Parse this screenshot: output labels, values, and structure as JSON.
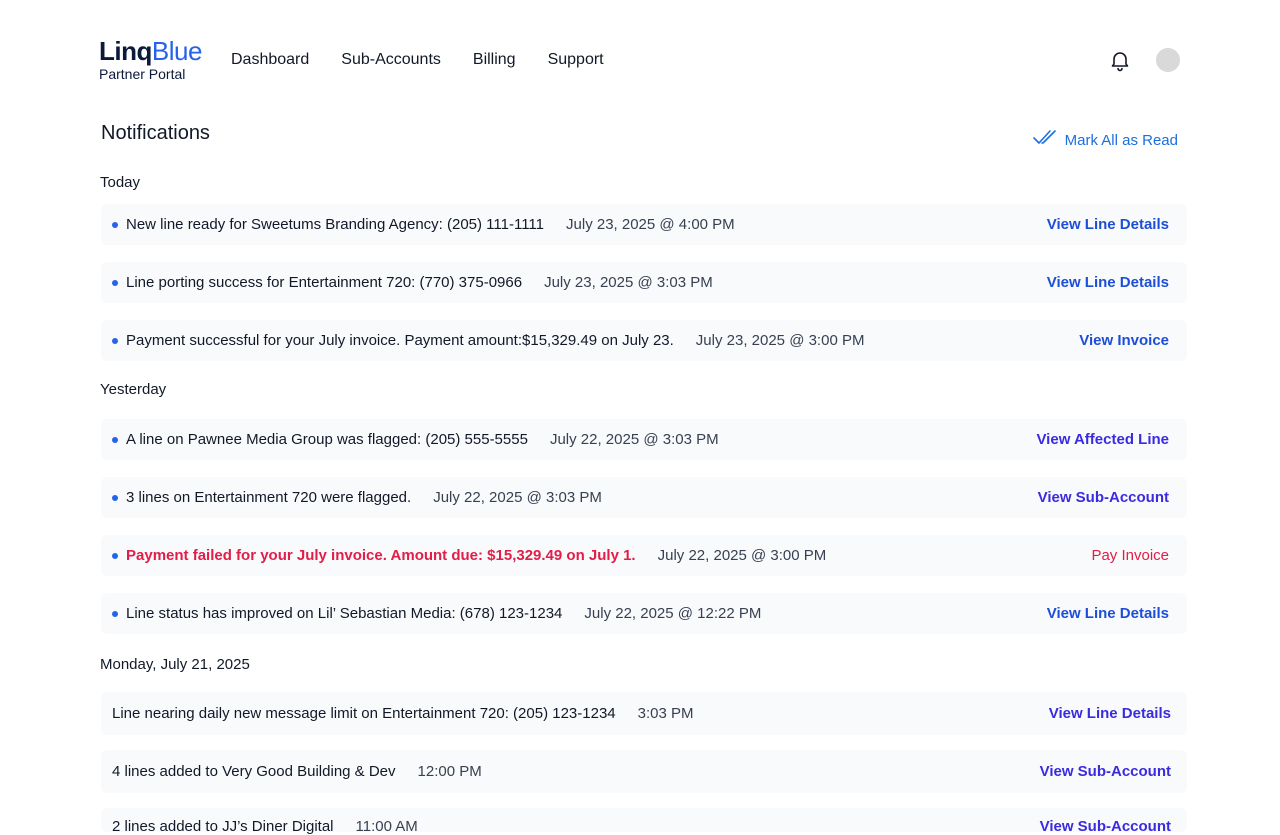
{
  "brand": {
    "name_bold": "Linq",
    "name_light": "Blue",
    "subtitle": "Partner Portal"
  },
  "nav": [
    {
      "label": "Dashboard"
    },
    {
      "label": "Sub-Accounts"
    },
    {
      "label": "Billing"
    },
    {
      "label": "Support"
    }
  ],
  "page": {
    "title": "Notifications",
    "mark_all_label": "Mark All as Read"
  },
  "sections": {
    "today": "Today",
    "yesterday": "Yesterday",
    "monday": "Monday, July 21, 2025"
  },
  "notifications": [
    {
      "message": "New line ready for Sweetums Branding Agency: (205) 111-1111",
      "time": "July 23, 2025 @ 4:00 PM",
      "action": "View Line Details"
    },
    {
      "message": "Line porting success for Entertainment 720: (770) 375-0966",
      "time": "July 23, 2025 @ 3:03 PM",
      "action": "View Line Details"
    },
    {
      "message": "Payment successful for your July invoice. Payment amount:$15,329.49 on July 23.",
      "time": "July 23, 2025 @ 3:00 PM",
      "action": "View Invoice"
    },
    {
      "message": "A line on Pawnee Media Group was flagged: (205) 555-5555",
      "time": "July 22, 2025 @ 3:03 PM",
      "action": "View Affected Line"
    },
    {
      "message": "3 lines on Entertainment 720 were flagged.",
      "time": "July 22, 2025 @ 3:03 PM",
      "action": "View Sub-Account"
    },
    {
      "message": "Payment failed for your July invoice. Amount due: $15,329.49 on July 1.",
      "time": "July 22, 2025 @ 3:00 PM",
      "action": "Pay Invoice"
    },
    {
      "message": "Line status has improved on Lil’ Sebastian Media: (678) 123-1234",
      "time": "July 22, 2025 @ 12:22 PM",
      "action": "View Line Details"
    },
    {
      "message": "Line nearing daily new message limit on Entertainment 720: (205) 123-1234",
      "time": "3:03 PM",
      "action": "View Line Details"
    },
    {
      "message": "4 lines added to Very Good Building & Dev",
      "time": "12:00 PM",
      "action": "View Sub-Account"
    },
    {
      "message": "2 lines added to JJ’s Diner Digital",
      "time": "11:00 AM",
      "action": "View Sub-Account"
    }
  ],
  "colors": {
    "accent": "#2563eb",
    "error": "#e11d48",
    "row_bg": "#f9fafc"
  },
  "icons": {
    "bell": "bell-icon",
    "mark_read": "double-check-icon",
    "unread": "unread-dot"
  }
}
